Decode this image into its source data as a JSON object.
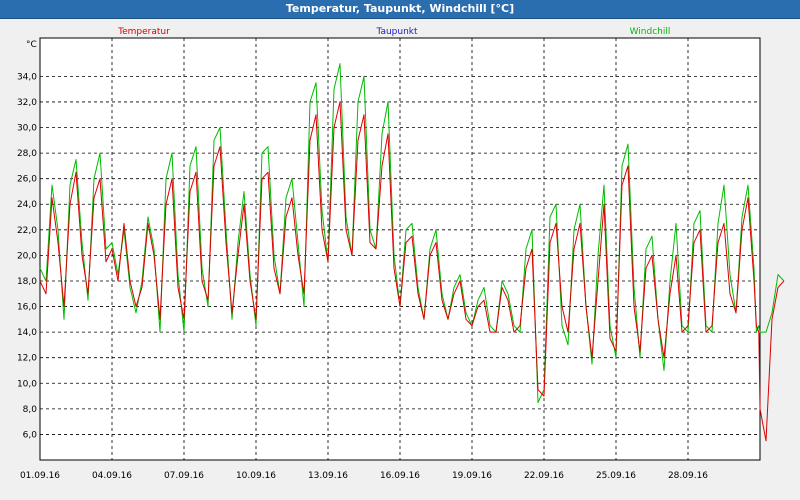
{
  "window": {
    "title": "Temperatur, Taupunkt, Windchill [°C]"
  },
  "colors": {
    "temperatur": "#dd0000",
    "taupunkt": "#1a1acc",
    "windchill": "#00bb00",
    "grid": "#000000",
    "background": "#ffffff",
    "titlebar": "#2a6eb0"
  },
  "chart_data": {
    "type": "line",
    "title": "Temperatur, Taupunkt, Windchill [°C]",
    "ylabel": "°C",
    "ylim": [
      4,
      37
    ],
    "xlim": [
      "01.09.16",
      "01.10.16"
    ],
    "yticks": [
      "6,0",
      "8,0",
      "10,0",
      "12,0",
      "14,0",
      "16,0",
      "18,0",
      "20,0",
      "22,0",
      "24,0",
      "26,0",
      "28,0",
      "30,0",
      "32,0",
      "34,0"
    ],
    "xticks": [
      "01.09.16",
      "04.09.16",
      "07.09.16",
      "10.09.16",
      "13.09.16",
      "16.09.16",
      "19.09.16",
      "22.09.16",
      "25.09.16",
      "28.09.16"
    ],
    "grid": true,
    "legend_position": "top",
    "series_order": [
      "temperatur",
      "windchill"
    ],
    "series": [
      {
        "name": "Temperatur",
        "key": "temperatur",
        "x_days": [
          0.0,
          0.25,
          0.5,
          0.75,
          1.0,
          1.25,
          1.5,
          1.75,
          2.0,
          2.25,
          2.5,
          2.75,
          3.0,
          3.25,
          3.5,
          3.75,
          4.0,
          4.25,
          4.5,
          4.75,
          5.0,
          5.25,
          5.5,
          5.75,
          6.0,
          6.25,
          6.5,
          6.75,
          7.0,
          7.25,
          7.5,
          7.75,
          8.0,
          8.25,
          8.5,
          8.75,
          9.0,
          9.25,
          9.5,
          9.75,
          10.0,
          10.25,
          10.5,
          10.75,
          11.0,
          11.25,
          11.5,
          11.75,
          12.0,
          12.25,
          12.5,
          12.75,
          13.0,
          13.25,
          13.5,
          13.75,
          14.0,
          14.25,
          14.5,
          14.75,
          15.0,
          15.25,
          15.5,
          15.75,
          16.0,
          16.25,
          16.5,
          16.75,
          17.0,
          17.25,
          17.5,
          17.75,
          18.0,
          18.25,
          18.5,
          18.75,
          19.0,
          19.25,
          19.5,
          19.75,
          20.0,
          20.25,
          20.5,
          20.75,
          21.0,
          21.25,
          21.5,
          21.75,
          22.0,
          22.25,
          22.5,
          22.75,
          23.0,
          23.25,
          23.5,
          23.75,
          24.0,
          24.25,
          24.5,
          24.75,
          25.0,
          25.25,
          25.5,
          25.75,
          26.0,
          26.25,
          26.5,
          26.75,
          27.0,
          27.25,
          27.5,
          27.75,
          28.0,
          28.25,
          28.5,
          28.75,
          29.0,
          29.25,
          29.5,
          29.75,
          29.85,
          29.95,
          30.0,
          30.25,
          30.5,
          30.75,
          31.0
        ],
        "values": [
          18.0,
          17.0,
          24.5,
          21.0,
          16.0,
          24.0,
          26.5,
          20.0,
          17.0,
          24.5,
          26.0,
          19.5,
          20.5,
          18.0,
          22.5,
          18.0,
          16.0,
          17.5,
          22.5,
          20.0,
          15.0,
          24.0,
          26.0,
          17.5,
          15.0,
          25.0,
          26.5,
          18.0,
          16.5,
          27.0,
          28.5,
          21.0,
          15.5,
          20.0,
          24.0,
          18.0,
          15.0,
          26.0,
          26.5,
          19.0,
          17.0,
          23.0,
          24.5,
          20.0,
          17.0,
          29.0,
          31.0,
          22.0,
          19.5,
          30.0,
          32.0,
          22.0,
          20.0,
          29.0,
          31.0,
          21.0,
          20.5,
          27.0,
          29.5,
          19.0,
          16.0,
          21.0,
          21.5,
          17.0,
          15.0,
          20.0,
          21.0,
          16.5,
          15.0,
          17.0,
          18.0,
          15.0,
          14.5,
          16.0,
          16.5,
          14.0,
          14.0,
          17.5,
          16.5,
          14.0,
          14.5,
          19.0,
          20.5,
          9.5,
          9.0,
          21.0,
          22.5,
          16.0,
          14.0,
          20.5,
          22.5,
          16.0,
          12.0,
          18.0,
          24.0,
          13.5,
          12.5,
          25.5,
          27.0,
          16.0,
          12.5,
          19.0,
          20.0,
          15.0,
          12.0,
          17.0,
          20.0,
          14.0,
          14.5,
          21.0,
          22.0,
          14.0,
          14.5,
          21.0,
          22.5,
          17.0,
          15.5,
          22.0,
          24.5,
          18.0,
          14.5,
          14.0,
          8.0,
          5.5,
          15.0,
          17.5,
          18.0,
          15.5
        ]
      },
      {
        "name": "Taupunkt",
        "key": "taupunkt",
        "x_days": [],
        "values": []
      },
      {
        "name": "Windchill",
        "key": "windchill",
        "x_days": [
          0.0,
          0.25,
          0.5,
          0.75,
          1.0,
          1.25,
          1.5,
          1.75,
          2.0,
          2.25,
          2.5,
          2.75,
          3.0,
          3.25,
          3.5,
          3.75,
          4.0,
          4.25,
          4.5,
          4.75,
          5.0,
          5.25,
          5.5,
          5.75,
          6.0,
          6.25,
          6.5,
          6.75,
          7.0,
          7.25,
          7.5,
          7.75,
          8.0,
          8.25,
          8.5,
          8.75,
          9.0,
          9.25,
          9.5,
          9.75,
          10.0,
          10.25,
          10.5,
          10.75,
          11.0,
          11.25,
          11.5,
          11.75,
          12.0,
          12.25,
          12.5,
          12.75,
          13.0,
          13.25,
          13.5,
          13.75,
          14.0,
          14.25,
          14.5,
          14.75,
          15.0,
          15.25,
          15.5,
          15.75,
          16.0,
          16.25,
          16.5,
          16.75,
          17.0,
          17.25,
          17.5,
          17.75,
          18.0,
          18.25,
          18.5,
          18.75,
          19.0,
          19.25,
          19.5,
          19.75,
          20.0,
          20.25,
          20.5,
          20.75,
          21.0,
          21.25,
          21.5,
          21.75,
          22.0,
          22.25,
          22.5,
          22.75,
          23.0,
          23.25,
          23.5,
          23.75,
          24.0,
          24.25,
          24.5,
          24.75,
          25.0,
          25.25,
          25.5,
          25.75,
          26.0,
          26.25,
          26.5,
          26.75,
          27.0,
          27.25,
          27.5,
          27.75,
          28.0,
          28.25,
          28.5,
          28.75,
          29.0,
          29.25,
          29.5,
          29.75,
          29.85,
          29.95,
          30.0,
          30.25,
          30.5,
          30.75,
          31.0
        ],
        "values": [
          19.0,
          18.0,
          25.5,
          22.0,
          15.0,
          25.5,
          27.5,
          21.0,
          16.5,
          26.0,
          28.0,
          20.5,
          21.0,
          18.5,
          22.0,
          17.5,
          15.5,
          18.0,
          23.0,
          20.5,
          14.0,
          26.0,
          28.0,
          18.5,
          14.0,
          27.0,
          28.5,
          19.0,
          16.0,
          29.0,
          30.0,
          22.0,
          15.0,
          21.0,
          25.0,
          18.5,
          14.5,
          28.0,
          28.5,
          20.0,
          17.0,
          24.5,
          26.0,
          21.0,
          16.0,
          32.0,
          33.5,
          23.5,
          19.5,
          33.0,
          35.0,
          23.0,
          20.0,
          32.0,
          34.0,
          22.0,
          20.5,
          29.5,
          32.0,
          20.0,
          16.0,
          22.0,
          22.5,
          17.5,
          15.0,
          20.5,
          22.0,
          17.0,
          15.0,
          17.5,
          18.5,
          15.5,
          14.5,
          16.5,
          17.5,
          14.5,
          14.0,
          18.0,
          17.0,
          14.5,
          14.0,
          20.5,
          22.0,
          8.5,
          9.5,
          23.0,
          24.0,
          14.5,
          13.0,
          22.0,
          24.0,
          16.0,
          11.5,
          20.0,
          25.5,
          14.5,
          12.0,
          27.0,
          28.7,
          17.5,
          12.0,
          20.5,
          21.5,
          15.0,
          11.0,
          18.0,
          22.5,
          14.5,
          14.0,
          22.5,
          23.5,
          14.5,
          14.0,
          22.5,
          25.5,
          18.5,
          15.5,
          23.0,
          25.5,
          19.0,
          14.0,
          14.5,
          14.0,
          14.0,
          15.5,
          18.5,
          18.0,
          15.5
        ]
      }
    ]
  }
}
